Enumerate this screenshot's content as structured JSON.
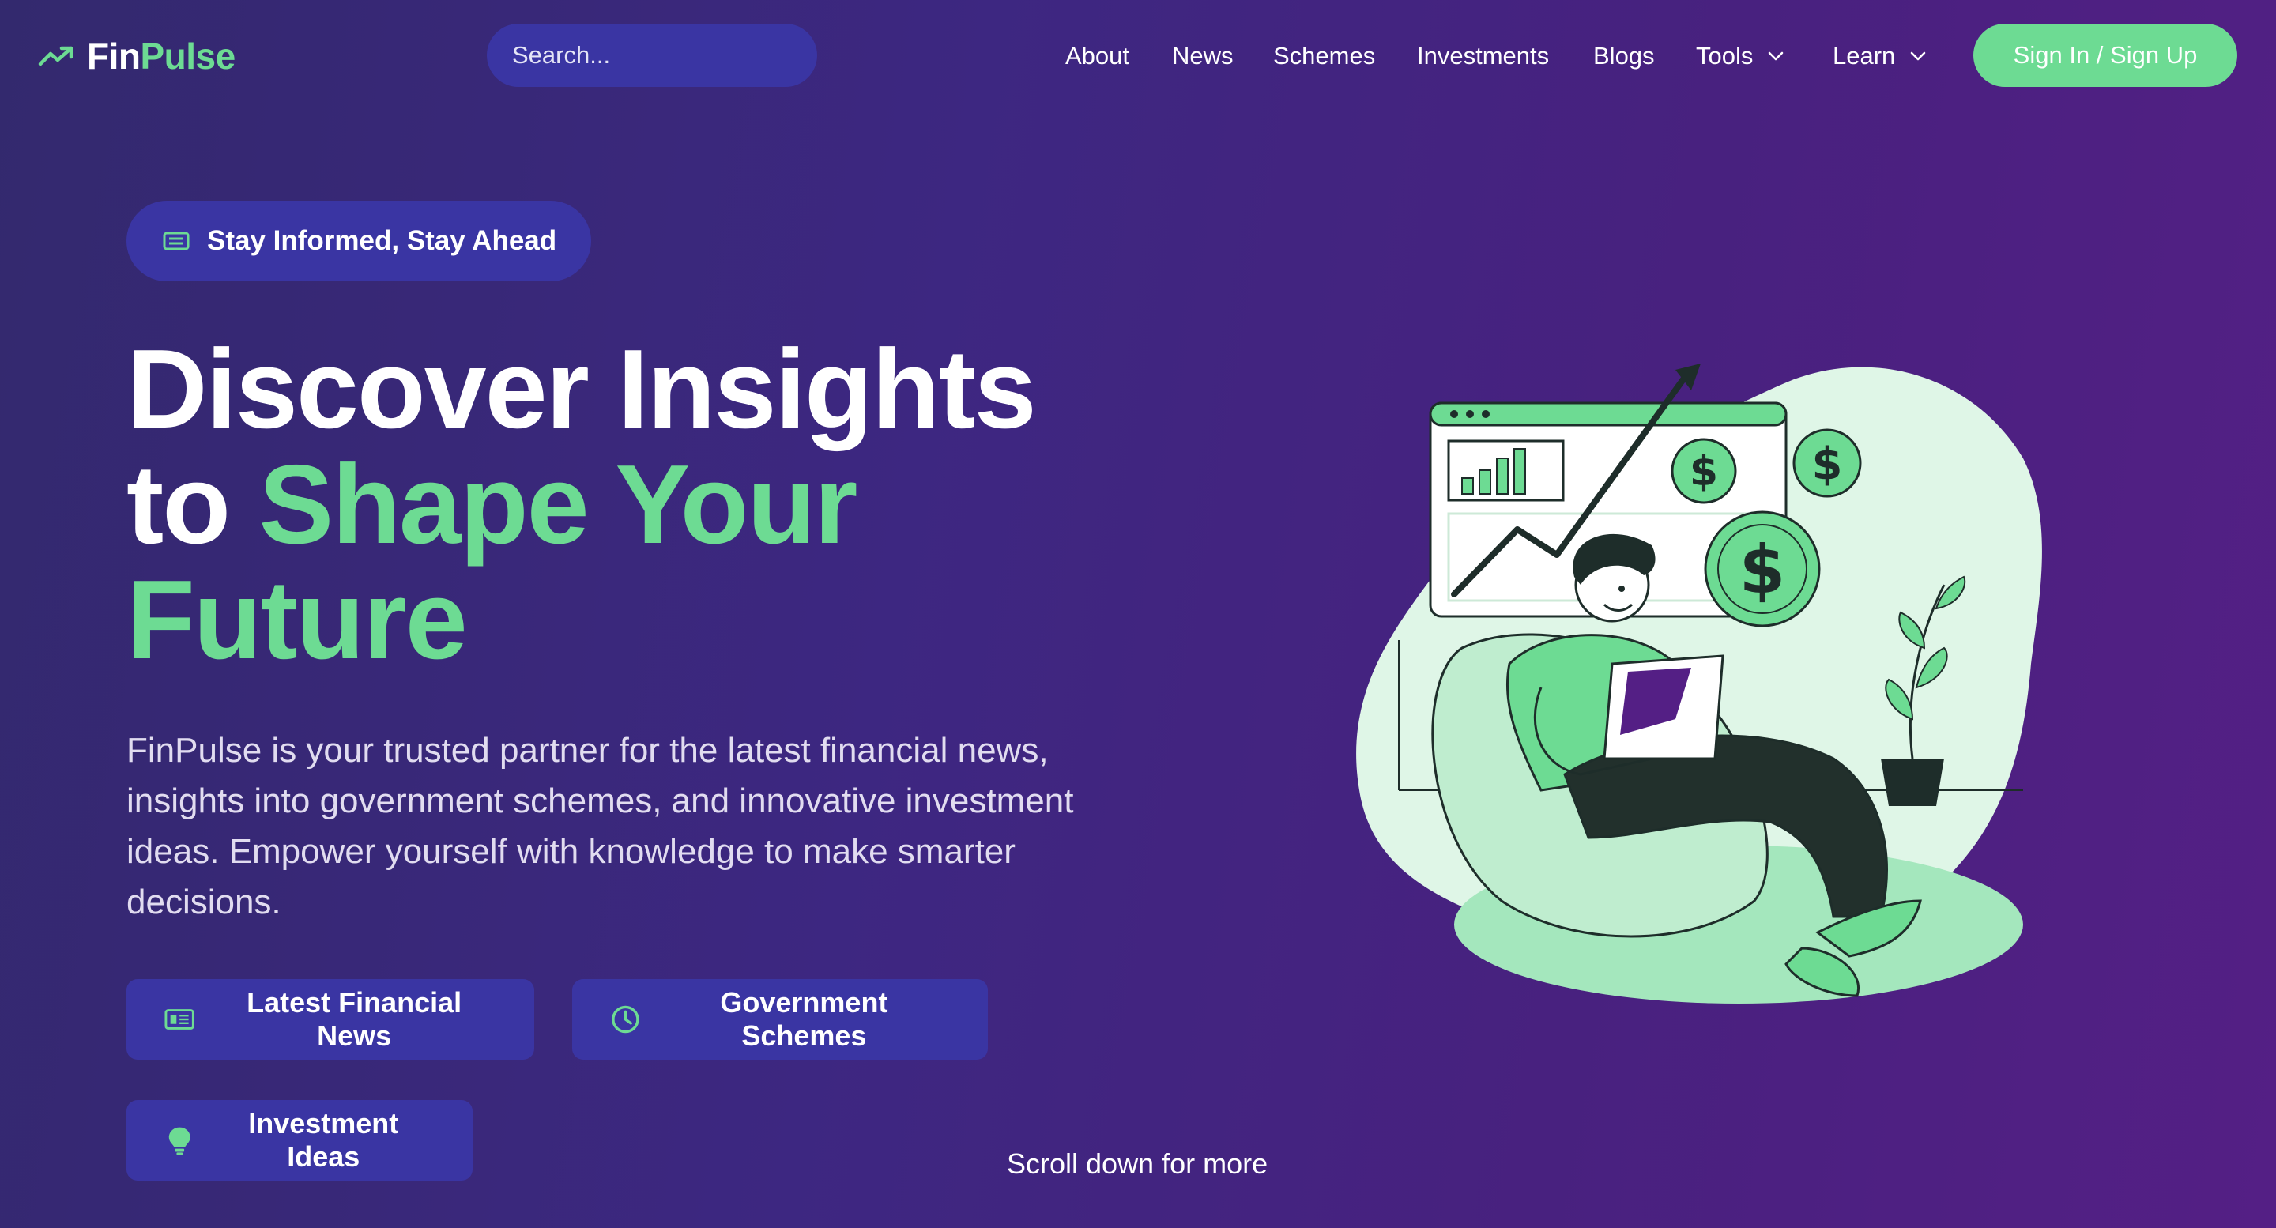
{
  "brand": {
    "name_part1": "Fin",
    "name_part2": "Pulse",
    "accent_color": "#6ddb93",
    "logo_icon": "trending-up-icon"
  },
  "search": {
    "placeholder": "Search...",
    "icon": "search-icon"
  },
  "nav": {
    "items": [
      {
        "label": "About"
      },
      {
        "label": "News"
      },
      {
        "label": "Schemes"
      },
      {
        "label": "Investments"
      },
      {
        "label": "Blogs"
      },
      {
        "label": "Tools",
        "dropdown": true
      },
      {
        "label": "Learn",
        "dropdown": true
      }
    ],
    "signin_label": "Sign In / Sign Up"
  },
  "hero": {
    "badge": "Stay Informed, Stay Ahead",
    "headline_white_1": "Discover Insights",
    "headline_white_2": "to ",
    "headline_green_1": "Shape Your",
    "headline_green_2": "Future",
    "description": "FinPulse is your trusted partner for the latest financial news, insights into government schemes, and innovative investment ideas. Empower yourself with knowledge to make smarter decisions.",
    "buttons": [
      {
        "label": "Latest Financial News",
        "icon": "newspaper-icon"
      },
      {
        "label": "Government Schemes",
        "icon": "clock-icon"
      },
      {
        "label": "Investment Ideas",
        "icon": "lightbulb-icon"
      }
    ],
    "scroll_hint": "Scroll down for more"
  },
  "colors": {
    "background_start": "#33296e",
    "background_end": "#541f85",
    "pill_background": "#3a35a3",
    "accent": "#6ddb93"
  }
}
